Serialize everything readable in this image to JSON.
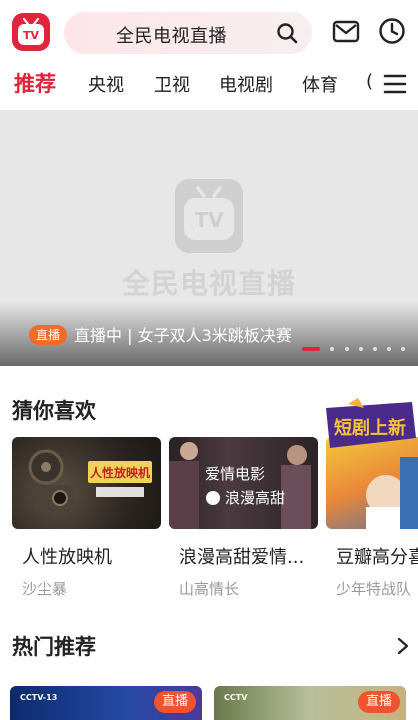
{
  "search": {
    "placeholder": "全民电视直播"
  },
  "tabs": [
    {
      "label": "推荐",
      "active": true
    },
    {
      "label": "央视",
      "active": false
    },
    {
      "label": "卫视",
      "active": false
    },
    {
      "label": "电视剧",
      "active": false
    },
    {
      "label": "体育",
      "active": false
    },
    {
      "label": "(",
      "active": false
    }
  ],
  "banner": {
    "brand": "全民电视直播",
    "badge": "直播",
    "title": "直播中 | 女子双人3米跳板决赛",
    "slide_count": 7,
    "active_slide": 1
  },
  "recommend": {
    "title": "猜你喜欢",
    "cards": [
      {
        "title": "人性放映机",
        "subtitle": "沙尘暴",
        "thumb_text": "人性放映机"
      },
      {
        "title": "浪漫高甜爱情...",
        "subtitle": "山高情长",
        "thumb_text": "爱情电影",
        "thumb_text2": "浪漫高甜"
      },
      {
        "title": "豆瓣高分喜",
        "subtitle": "少年特战队",
        "thumb_text": "短剧上新"
      }
    ]
  },
  "hot": {
    "title": "热门推荐",
    "cards": [
      {
        "badge": "直播",
        "logo": "CCTV-13"
      },
      {
        "badge": "直播",
        "logo": "CCTV"
      }
    ]
  },
  "colors": {
    "accent": "#e0243b",
    "live_orange": "#f26b2a"
  },
  "icons": [
    "app-logo-icon",
    "search-icon",
    "mail-icon",
    "clock-icon",
    "menu-icon",
    "chevron-right-icon"
  ]
}
